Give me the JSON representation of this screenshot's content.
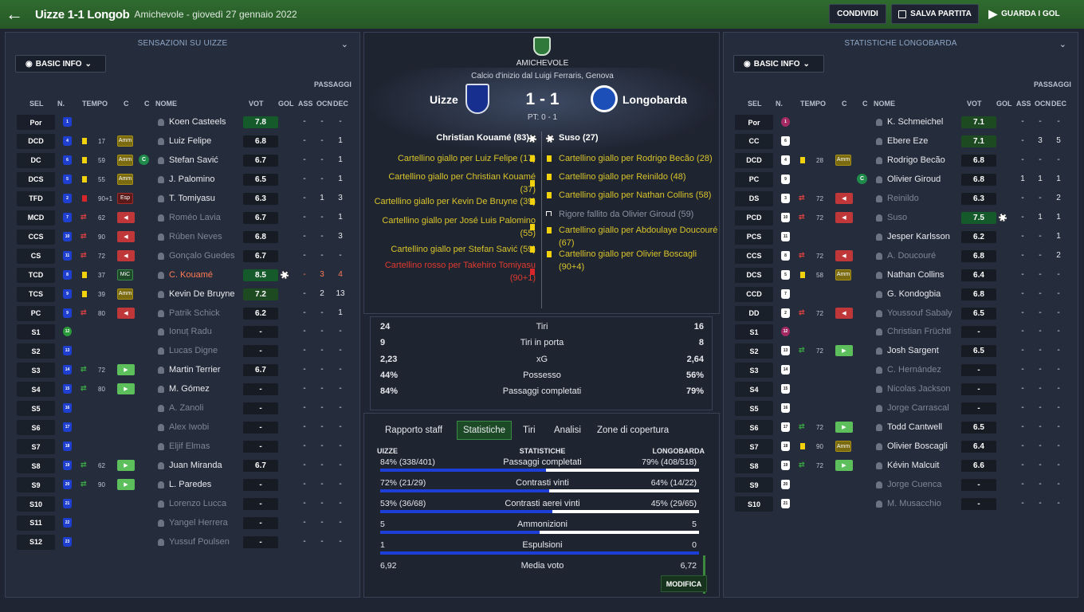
{
  "header": {
    "title": "Uizze 1-1 Longob",
    "subtitle": "Amichevole - giovedì 27 gennaio 2022",
    "share": "CONDIVIDI",
    "save": "SALVA PARTITA",
    "watch": "GUARDA I GOL"
  },
  "left": {
    "title": "SENSAZIONI SU UIZZE",
    "basic": "BASIC INFO",
    "passaggi": "PASSAGGI",
    "cols": {
      "sel": "SEL",
      "n": "N.",
      "tempo": "TEMPO",
      "c1": "C",
      "c2": "C",
      "nome": "NOME",
      "vot": "VOT",
      "gol": "GOL",
      "ass": "ASS",
      "ocn": "OCN",
      "dec": "DEC"
    },
    "rows": [
      {
        "pos": "Por",
        "num": "1",
        "name": "Koen Casteels",
        "rating": "7.8",
        "ass": "-",
        "ocn": "-",
        "dec": "-"
      },
      {
        "pos": "DCD",
        "num": "4",
        "card": "y",
        "min": "17",
        "badge": "Amm",
        "name": "Luiz Felipe",
        "rating": "6.8",
        "ass": "-",
        "ocn": "-",
        "dec": "1"
      },
      {
        "pos": "DC",
        "num": "6",
        "card": "y",
        "min": "59",
        "badge": "Amm",
        "cap": "C",
        "name": "Stefan Savić",
        "rating": "6.7",
        "ass": "-",
        "ocn": "-",
        "dec": "1"
      },
      {
        "pos": "DCS",
        "num": "5",
        "card": "y",
        "min": "55",
        "badge": "Amm",
        "name": "J. Palomino",
        "rating": "6.5",
        "ass": "-",
        "ocn": "-",
        "dec": "1"
      },
      {
        "pos": "TFD",
        "num": "2",
        "card": "r",
        "min": "90+1",
        "badge": "Esp",
        "name": "T. Tomiyasu",
        "rating": "6.3",
        "ass": "-",
        "ocn": "1",
        "dec": "3"
      },
      {
        "pos": "MCD",
        "num": "7",
        "subout": "1",
        "min": "62",
        "name": "Roméo Lavia",
        "rating": "6.7",
        "ass": "-",
        "ocn": "-",
        "dec": "1",
        "dim": "1"
      },
      {
        "pos": "CCS",
        "num": "10",
        "subout": "1",
        "min": "90",
        "name": "Rúben Neves",
        "rating": "6.8",
        "ass": "-",
        "ocn": "-",
        "dec": "3",
        "dim": "1"
      },
      {
        "pos": "CS",
        "num": "11",
        "subout": "1",
        "min": "72",
        "name": "Gonçalo Guedes",
        "rating": "6.7",
        "ass": "-",
        "ocn": "-",
        "dec": "-",
        "dim": "1"
      },
      {
        "pos": "TCD",
        "num": "8",
        "card": "y",
        "min": "37",
        "badge": "MiC",
        "name": "C. Kouamé",
        "rating": "8.5",
        "ball": "1",
        "ass": "-",
        "ocn": "3",
        "dec": "4",
        "red": "1"
      },
      {
        "pos": "TCS",
        "num": "9",
        "card": "y",
        "min": "39",
        "badge": "Amm",
        "name": "Kevin De Bruyne",
        "rating": "7.2",
        "ass": "-",
        "ocn": "2",
        "dec": "13"
      },
      {
        "pos": "PC",
        "num": "9",
        "subout": "1",
        "min": "80",
        "name": "Patrik Schick",
        "rating": "6.2",
        "ass": "-",
        "ocn": "-",
        "dec": "1",
        "dim": "1"
      },
      {
        "pos": "S1",
        "num": "12",
        "name": "Ionuț Radu",
        "rating": "-",
        "ass": "-",
        "ocn": "-",
        "dec": "-",
        "dim": "1",
        "gk": "1"
      },
      {
        "pos": "S2",
        "num": "13",
        "name": "Lucas Digne",
        "rating": "-",
        "ass": "-",
        "ocn": "-",
        "dec": "-",
        "dim": "1"
      },
      {
        "pos": "S3",
        "num": "14",
        "subin": "1",
        "min": "72",
        "name": "Martin Terrier",
        "rating": "6.7",
        "ass": "-",
        "ocn": "-",
        "dec": "-"
      },
      {
        "pos": "S4",
        "num": "15",
        "subin": "1",
        "min": "80",
        "name": "M. Gómez",
        "rating": "-",
        "ass": "-",
        "ocn": "-",
        "dec": "-"
      },
      {
        "pos": "S5",
        "num": "16",
        "name": "A. Zanoli",
        "rating": "-",
        "ass": "-",
        "ocn": "-",
        "dec": "-",
        "dim": "1"
      },
      {
        "pos": "S6",
        "num": "17",
        "name": "Alex Iwobi",
        "rating": "-",
        "ass": "-",
        "ocn": "-",
        "dec": "-",
        "dim": "1"
      },
      {
        "pos": "S7",
        "num": "18",
        "name": "Eljif Elmas",
        "rating": "-",
        "ass": "-",
        "ocn": "-",
        "dec": "-",
        "dim": "1"
      },
      {
        "pos": "S8",
        "num": "19",
        "subin": "1",
        "min": "62",
        "name": "Juan Miranda",
        "rating": "6.7",
        "ass": "-",
        "ocn": "-",
        "dec": "-"
      },
      {
        "pos": "S9",
        "num": "20",
        "subin": "1",
        "min": "90",
        "name": "L. Paredes",
        "rating": "-",
        "ass": "-",
        "ocn": "-",
        "dec": "-"
      },
      {
        "pos": "S10",
        "num": "21",
        "name": "Lorenzo Lucca",
        "rating": "-",
        "ass": "-",
        "ocn": "-",
        "dec": "-",
        "dim": "1"
      },
      {
        "pos": "S11",
        "num": "22",
        "name": "Yangel Herrera",
        "rating": "-",
        "ass": "-",
        "ocn": "-",
        "dec": "-",
        "dim": "1"
      },
      {
        "pos": "S12",
        "num": "23",
        "name": "Yussuf Poulsen",
        "rating": "-",
        "ass": "-",
        "ocn": "-",
        "dec": "-",
        "dim": "1"
      }
    ]
  },
  "right": {
    "title": "STATISTICHE LONGOBARDA",
    "basic": "BASIC INFO",
    "passaggi": "PASSAGGI",
    "cols": {
      "sel": "SEL",
      "n": "N.",
      "tempo": "TEMPO",
      "c1": "C",
      "c2": "C",
      "nome": "NOME",
      "vot": "VOT",
      "gol": "GOL",
      "ass": "ASS",
      "ocn": "OCN",
      "dec": "DEC"
    },
    "rows": [
      {
        "pos": "Por",
        "num": "1",
        "name": "K. Schmeichel",
        "rating": "7.1",
        "ass": "-",
        "ocn": "-",
        "dec": "-",
        "gk": "1"
      },
      {
        "pos": "CC",
        "num": "6",
        "name": "Ebere Eze",
        "rating": "7.1",
        "ass": "-",
        "ocn": "3",
        "dec": "5"
      },
      {
        "pos": "DCD",
        "num": "4",
        "card": "y",
        "min": "28",
        "badge": "Amm",
        "name": "Rodrigo Becão",
        "rating": "6.8",
        "ass": "-",
        "ocn": "-",
        "dec": "-"
      },
      {
        "pos": "PC",
        "num": "9",
        "cap": "C",
        "name": "Olivier Giroud",
        "rating": "6.8",
        "ass": "1",
        "ocn": "1",
        "dec": "1"
      },
      {
        "pos": "DS",
        "num": "3",
        "subout": "1",
        "min": "72",
        "name": "Reinildo",
        "rating": "6.3",
        "ass": "-",
        "ocn": "-",
        "dec": "2",
        "dim": "1"
      },
      {
        "pos": "PCD",
        "num": "10",
        "subout": "1",
        "min": "72",
        "name": "Suso",
        "rating": "7.5",
        "ball": "1",
        "ass": "-",
        "ocn": "1",
        "dec": "1",
        "dim": "1"
      },
      {
        "pos": "PCS",
        "num": "11",
        "name": "Jesper Karlsson",
        "rating": "6.2",
        "ass": "-",
        "ocn": "-",
        "dec": "1"
      },
      {
        "pos": "CCS",
        "num": "8",
        "subout": "1",
        "min": "72",
        "name": "A. Doucouré",
        "rating": "6.8",
        "ass": "-",
        "ocn": "-",
        "dec": "2",
        "dim": "1"
      },
      {
        "pos": "DCS",
        "num": "5",
        "card": "y",
        "min": "58",
        "badge": "Amm",
        "name": "Nathan Collins",
        "rating": "6.4",
        "ass": "-",
        "ocn": "-",
        "dec": "-"
      },
      {
        "pos": "CCD",
        "num": "7",
        "name": "G. Kondogbia",
        "rating": "6.8",
        "ass": "-",
        "ocn": "-",
        "dec": "-"
      },
      {
        "pos": "DD",
        "num": "2",
        "subout": "1",
        "min": "72",
        "name": "Youssouf Sabaly",
        "rating": "6.5",
        "ass": "-",
        "ocn": "-",
        "dec": "-",
        "dim": "1"
      },
      {
        "pos": "S1",
        "num": "12",
        "name": "Christian Früchtl",
        "rating": "-",
        "ass": "-",
        "ocn": "-",
        "dec": "-",
        "dim": "1",
        "gk": "1"
      },
      {
        "pos": "S2",
        "num": "13",
        "subin": "1",
        "min": "72",
        "name": "Josh Sargent",
        "rating": "6.5",
        "ass": "-",
        "ocn": "-",
        "dec": "-"
      },
      {
        "pos": "S3",
        "num": "14",
        "name": "C. Hernández",
        "rating": "-",
        "ass": "-",
        "ocn": "-",
        "dec": "-",
        "dim": "1"
      },
      {
        "pos": "S4",
        "num": "15",
        "name": "Nicolas Jackson",
        "rating": "-",
        "ass": "-",
        "ocn": "-",
        "dec": "-",
        "dim": "1"
      },
      {
        "pos": "S5",
        "num": "16",
        "name": "Jorge Carrascal",
        "rating": "-",
        "ass": "-",
        "ocn": "-",
        "dec": "-",
        "dim": "1"
      },
      {
        "pos": "S6",
        "num": "17",
        "subin": "1",
        "min": "72",
        "name": "Todd Cantwell",
        "rating": "6.5",
        "ass": "-",
        "ocn": "-",
        "dec": "-"
      },
      {
        "pos": "S7",
        "num": "18",
        "card": "y",
        "min": "90",
        "badge": "Amm",
        "name": "Olivier Boscagli",
        "rating": "6.4",
        "ass": "-",
        "ocn": "-",
        "dec": "-"
      },
      {
        "pos": "S8",
        "num": "19",
        "subin": "1",
        "min": "72",
        "name": "Kévin Malcuit",
        "rating": "6.6",
        "ass": "-",
        "ocn": "-",
        "dec": "-"
      },
      {
        "pos": "S9",
        "num": "20",
        "name": "Jorge Cuenca",
        "rating": "-",
        "ass": "-",
        "ocn": "-",
        "dec": "-",
        "dim": "1"
      },
      {
        "pos": "S10",
        "num": "21",
        "name": "M. Musacchio",
        "rating": "-",
        "ass": "-",
        "ocn": "-",
        "dec": "-",
        "dim": "1"
      }
    ]
  },
  "match": {
    "competition": "AMICHEVOLE",
    "kickoff": "Calcio d'inizio dal Luigi Ferraris, Genova",
    "home": "Uizze",
    "away": "Longobarda",
    "score": "1 - 1",
    "ht": "PT: 0 - 1",
    "home_scorer": "Christian Kouamé (83)",
    "away_scorer": "Suso (27)",
    "home_events": [
      {
        "l1": "Cartellino giallo per Luiz Felipe (17)",
        "t": "y"
      },
      {
        "l1": "Cartellino giallo per Christian Kouamé",
        "l2": "(37)",
        "t": "y"
      },
      {
        "l1": "Cartellino giallo per Kevin De Bruyne (39)",
        "t": "y"
      },
      {
        "l1": "Cartellino giallo per José Luis Palomino",
        "l2": "(55)",
        "t": "y"
      },
      {
        "l1": "Cartellino giallo per Stefan Savić (59)",
        "t": "y"
      },
      {
        "l1": "Cartellino rosso per Takehiro Tomiyasu",
        "l2": "(90+1)",
        "t": "r"
      }
    ],
    "away_events": [
      {
        "l1": "Cartellino giallo per Rodrigo Becão (28)",
        "t": "y"
      },
      {
        "l1": "Cartellino giallo per Reinildo (48)",
        "t": "y"
      },
      {
        "l1": "Cartellino giallo per Nathan Collins (58)",
        "t": "y"
      },
      {
        "l1": "Rigore fallito da Olivier Giroud (59)",
        "t": "p"
      },
      {
        "l1": "Cartellino giallo per Abdoulaye Doucouré",
        "l2": "(67)",
        "t": "y"
      },
      {
        "l1": "Cartellino giallo per Olivier Boscagli",
        "l2": "(90+4)",
        "t": "y"
      }
    ]
  },
  "summary": [
    {
      "h": "24",
      "label": "Tiri",
      "a": "16"
    },
    {
      "h": "9",
      "label": "Tiri in porta",
      "a": "8"
    },
    {
      "h": "2,23",
      "label": "xG",
      "a": "2,64"
    },
    {
      "h": "44%",
      "label": "Possesso",
      "a": "56%"
    },
    {
      "h": "84%",
      "label": "Passaggi completati",
      "a": "79%"
    }
  ],
  "tabs": [
    "Rapporto staff",
    "Statistiche",
    "Tiri",
    "Analisi",
    "Zone di copertura"
  ],
  "compare": {
    "home": "UIZZE",
    "mid": "STATISTICHE",
    "away": "LONGOBARDA",
    "edit": "MODIFICA",
    "rows": [
      {
        "h": "84% (338/401)",
        "label": "Passaggi completati",
        "a": "79% (408/518)",
        "frac": 0.52
      },
      {
        "h": "72% (21/29)",
        "label": "Contrasti vinti",
        "a": "64% (14/22)",
        "frac": 0.53
      },
      {
        "h": "53% (36/68)",
        "label": "Contrasti aerei vinti",
        "a": "45% (29/65)",
        "frac": 0.54
      },
      {
        "h": "5",
        "label": "Ammonizioni",
        "a": "5",
        "frac": 0.5
      },
      {
        "h": "1",
        "label": "Espulsioni",
        "a": "0",
        "frac": 1.0
      },
      {
        "h": "6,92",
        "label": "Media voto",
        "a": "6,72",
        "frac": null
      }
    ]
  },
  "colors": {
    "accent": "#2f6b2f",
    "home_shirt": "#1e3fd0",
    "away_shirt": "#ffffff",
    "yellow": "#f2d20c",
    "red": "#d8262b",
    "bar": "#1d3fd8"
  }
}
